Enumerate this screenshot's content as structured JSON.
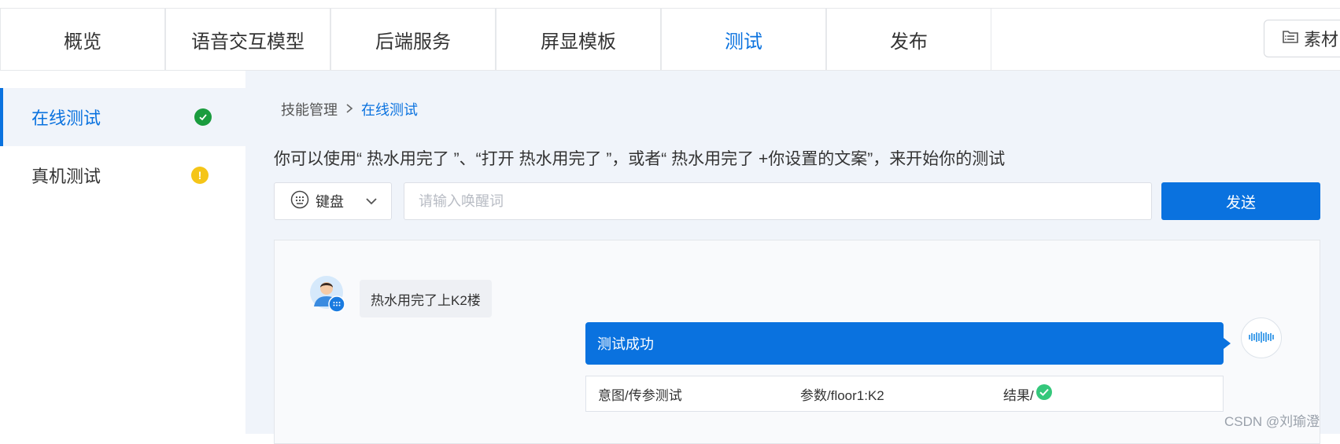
{
  "top_nav": {
    "tabs": [
      {
        "label": "概览",
        "active": false
      },
      {
        "label": "语音交互模型",
        "active": false
      },
      {
        "label": "后端服务",
        "active": false
      },
      {
        "label": "屏显模板",
        "active": false
      },
      {
        "label": "测试",
        "active": true
      },
      {
        "label": "发布",
        "active": false
      }
    ],
    "asset_button_label": "素材",
    "asset_icon": "folder-list-icon"
  },
  "sidebar": {
    "items": [
      {
        "label": "在线测试",
        "status": "success",
        "status_icon": "check-circle-icon",
        "status_color": "#1a9c3e",
        "active": true
      },
      {
        "label": "真机测试",
        "status": "warning",
        "status_icon": "exclamation-circle-icon",
        "status_color": "#f5c518",
        "active": false
      }
    ]
  },
  "breadcrumb": {
    "parent": "技能管理",
    "current": "在线测试",
    "separator_icon": "chevron-right-icon"
  },
  "hint_text": "你可以使用“ 热水用完了 ”、“打开 热水用完了 ”，或者“ 热水用完了 +你设置的文案”，来开始你的测试",
  "input_bar": {
    "mode_label": "键盘",
    "mode_icon": "keyboard-icon",
    "dropdown_icon": "chevron-down-icon",
    "wake_input_value": "",
    "wake_input_placeholder": "请输入唤醒词",
    "send_label": "发送"
  },
  "chat": {
    "user_message": "热水用完了上K2楼",
    "bot_message": "测试成功",
    "bot_avatar_icon": "voice-wave-icon",
    "result": {
      "intent": "意图/传参测试",
      "params": "参数/floor1:K2",
      "result_label": "结果/",
      "result_icon": "check-circle-icon"
    }
  },
  "watermark": "CSDN @刘瑜澄",
  "colors": {
    "accent": "#0a72df",
    "background": "#f0f4fa",
    "success": "#1a9c3e",
    "warning": "#f5c518",
    "result_success": "#34c77b"
  }
}
